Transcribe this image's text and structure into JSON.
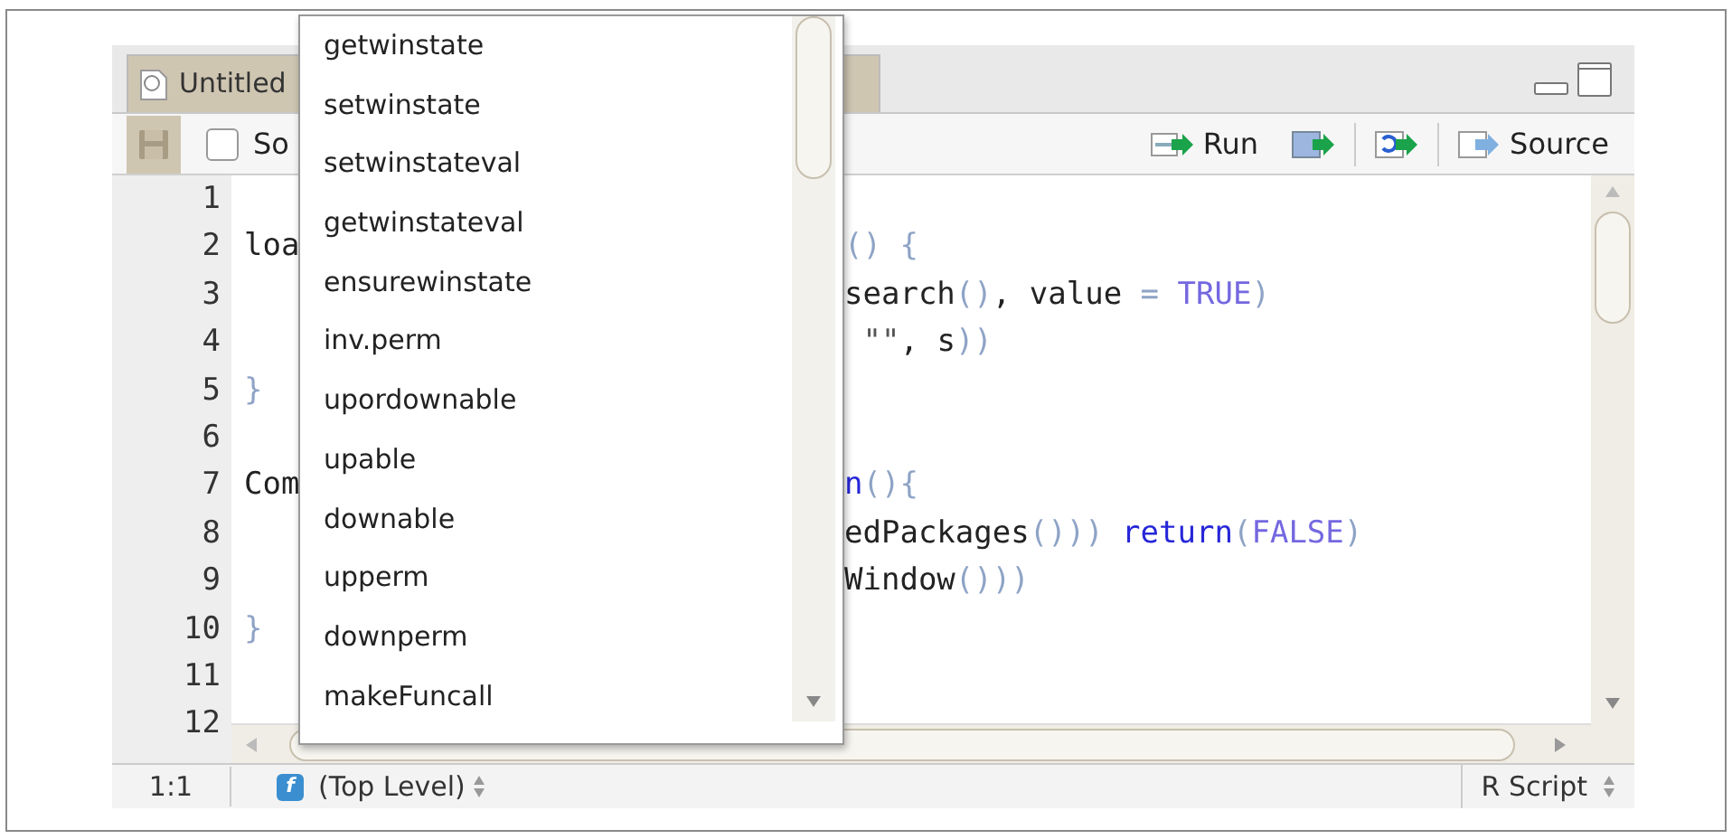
{
  "tab": {
    "title": "Untitled",
    "selected": true
  },
  "toolbar": {
    "source_on_save": {
      "label": "So",
      "checked": false
    },
    "buttons": [
      {
        "kind": "run",
        "label": "Run"
      },
      {
        "kind": "run-region"
      },
      {
        "kind": "rerun"
      },
      {
        "kind": "source",
        "label": "Source"
      }
    ]
  },
  "editor": {
    "lines": [
      {
        "number": "1"
      },
      {
        "number": "2",
        "left": [
          {
            "text": "loa",
            "kind": "plain"
          }
        ],
        "right": [
          {
            "text": "()",
            "kind": "paren"
          },
          {
            "text": " {",
            "kind": "paren"
          }
        ]
      },
      {
        "number": "3",
        "right": [
          {
            "text": "search",
            "kind": "plain"
          },
          {
            "text": "()",
            "kind": "paren"
          },
          {
            "text": ", value ",
            "kind": "plain"
          },
          {
            "text": "= ",
            "kind": "paren"
          },
          {
            "text": "TRUE",
            "kind": "constant"
          },
          {
            "text": ")",
            "kind": "paren"
          }
        ]
      },
      {
        "number": "4",
        "right": [
          {
            "text": " \"\"",
            "kind": "string"
          },
          {
            "text": ", s",
            "kind": "plain"
          },
          {
            "text": "))",
            "kind": "paren"
          }
        ]
      },
      {
        "number": "5",
        "left": [
          {
            "text": "}",
            "kind": "paren"
          }
        ]
      },
      {
        "number": "6"
      },
      {
        "number": "7",
        "left": [
          {
            "text": "Com",
            "kind": "plain"
          }
        ],
        "right": [
          {
            "text": "n",
            "kind": "keyword"
          },
          {
            "text": "(){",
            "kind": "paren"
          }
        ]
      },
      {
        "number": "8",
        "right": [
          {
            "text": "edPackages",
            "kind": "plain"
          },
          {
            "text": "()))",
            "kind": "paren"
          },
          {
            "text": " return",
            "kind": "keyword"
          },
          {
            "text": "(",
            "kind": "paren"
          },
          {
            "text": "FALSE",
            "kind": "constant"
          },
          {
            "text": ")",
            "kind": "paren"
          }
        ]
      },
      {
        "number": "9",
        "right": [
          {
            "text": "Window",
            "kind": "plain"
          },
          {
            "text": "()))",
            "kind": "paren"
          }
        ]
      },
      {
        "number": "10",
        "left": [
          {
            "text": "}",
            "kind": "paren"
          }
        ]
      },
      {
        "number": "11"
      },
      {
        "number": "12"
      }
    ]
  },
  "autocomplete": {
    "items": [
      "getwinstate",
      "setwinstate",
      "setwinstateval",
      "getwinstateval",
      "ensurewinstate",
      "inv.perm",
      "upordownable",
      "upable",
      "downable",
      "upperm",
      "downperm",
      "makeFuncall"
    ]
  },
  "status_bar": {
    "position": "1:1",
    "scope_icon": "f",
    "scope": "(Top Level)",
    "file_type": "R Script"
  }
}
